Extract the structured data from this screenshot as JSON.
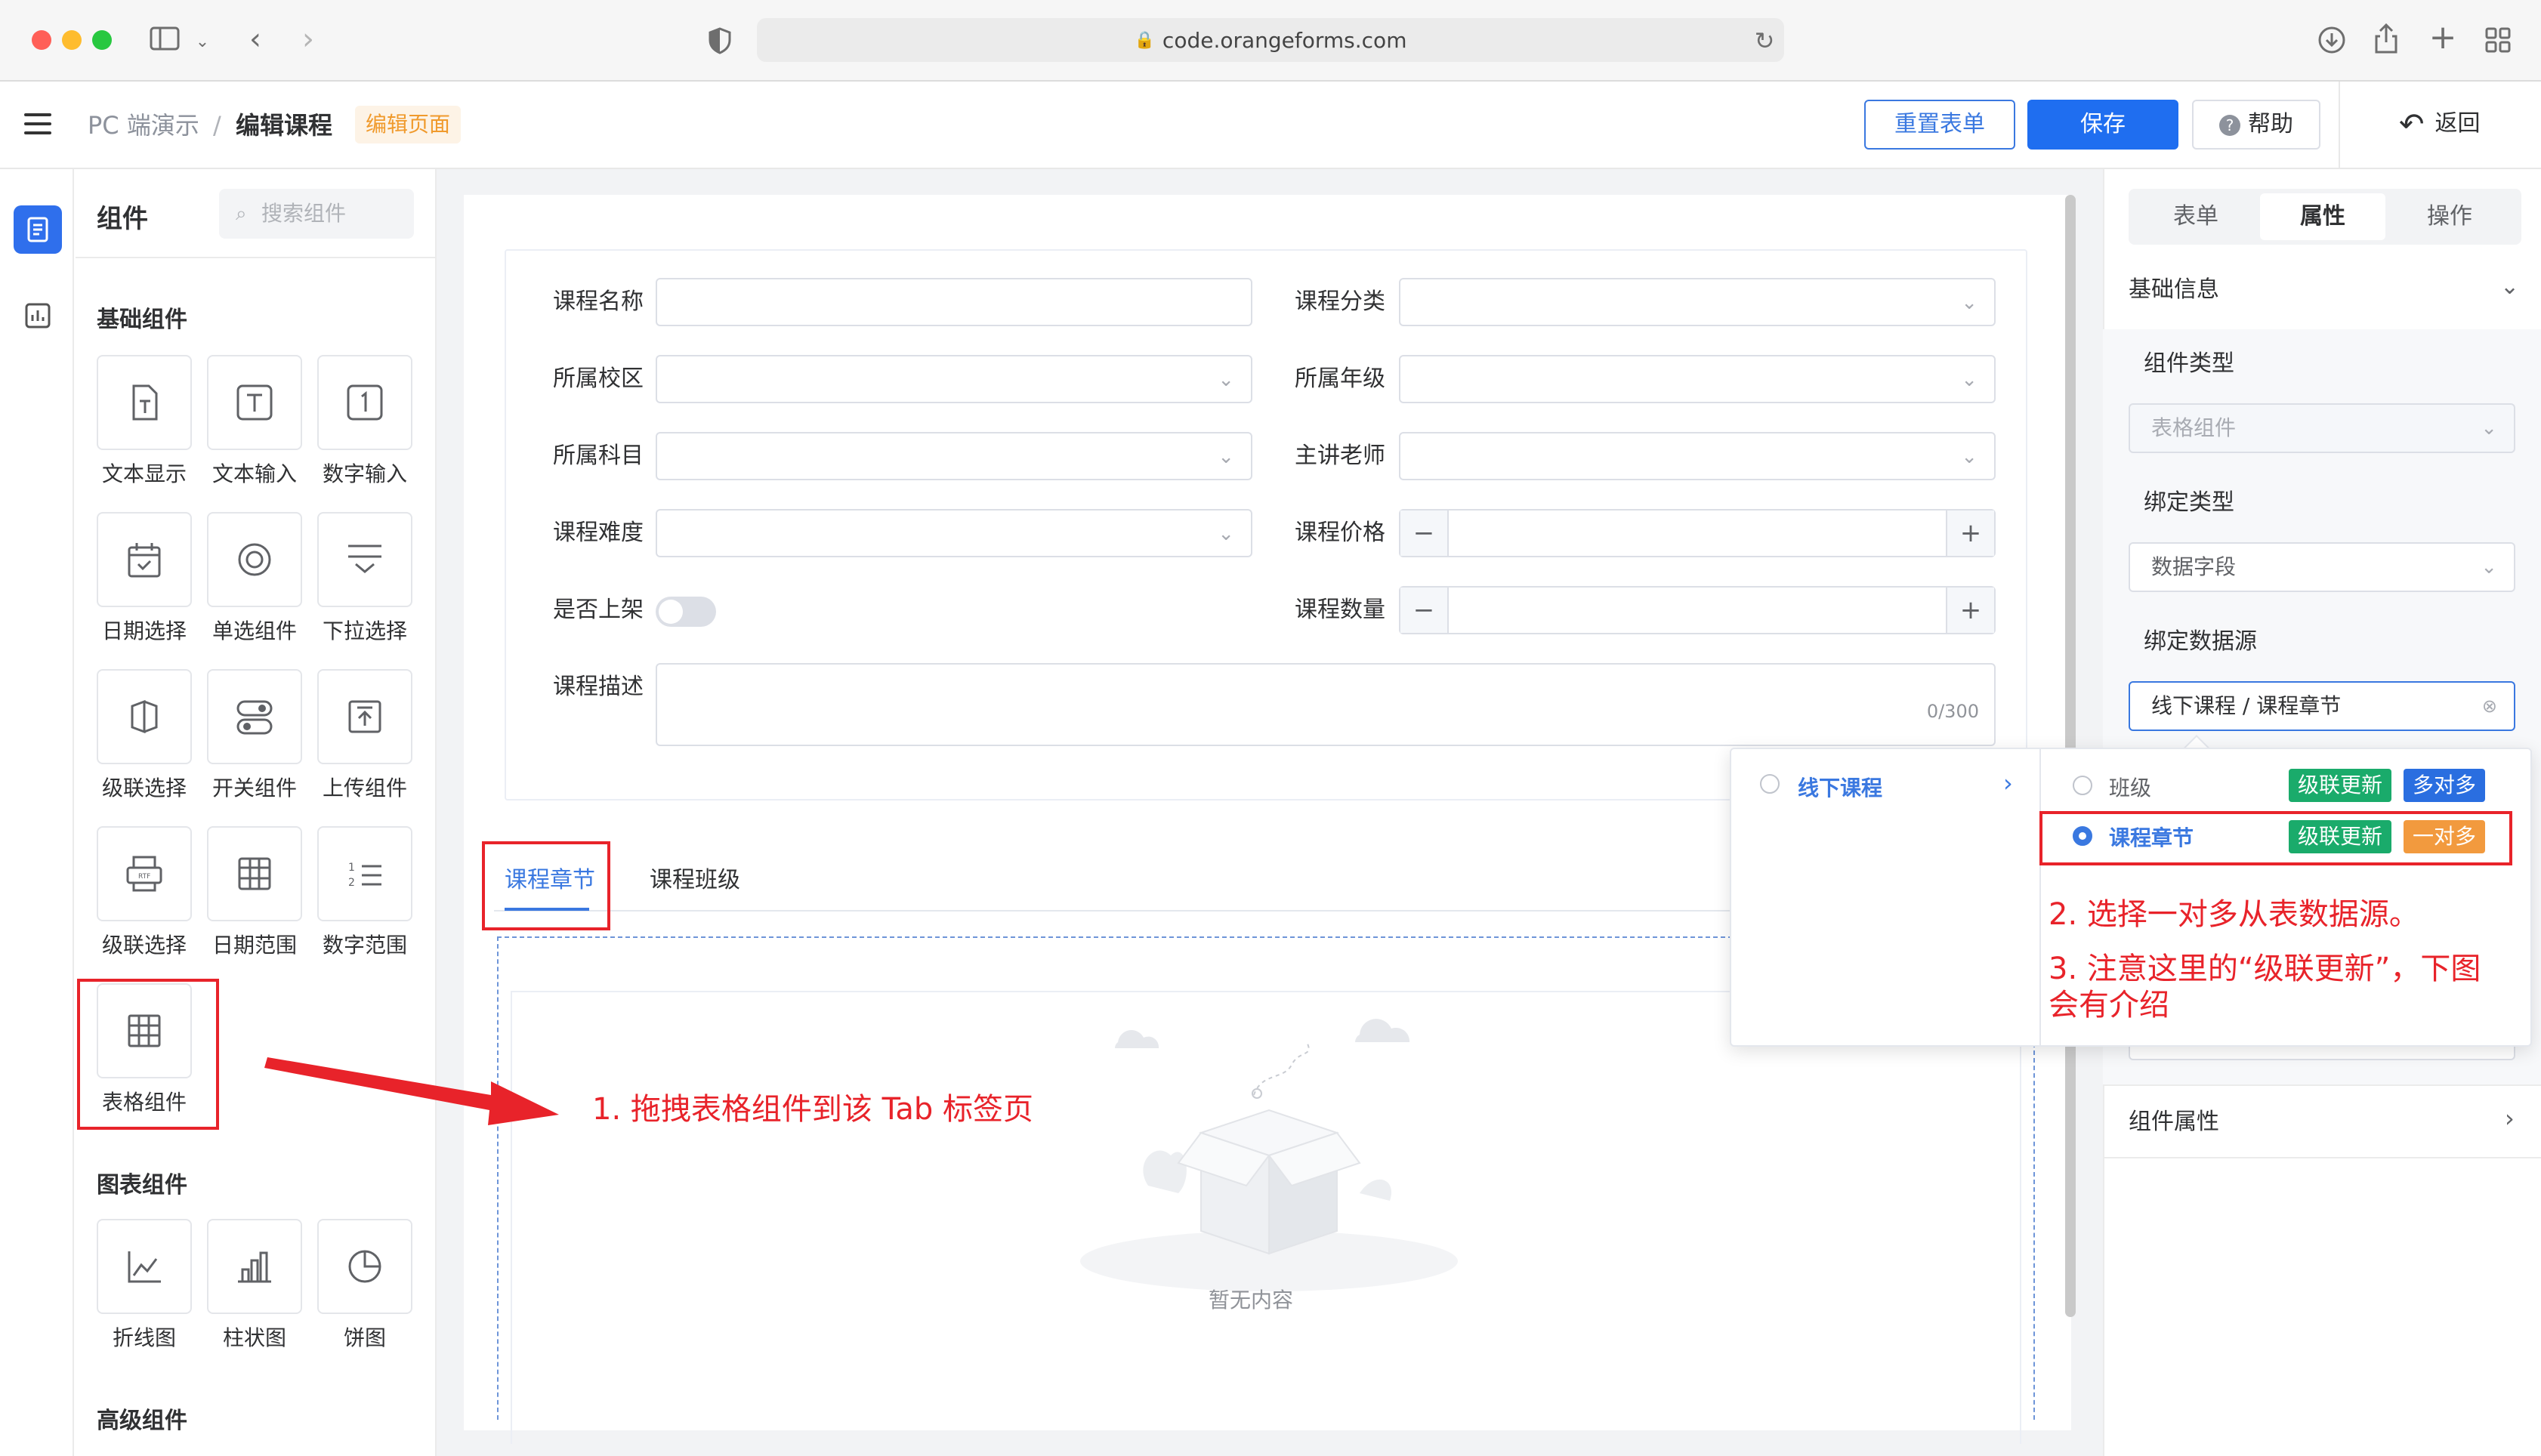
{
  "browser": {
    "url": "code.orangeforms.com"
  },
  "header": {
    "breadcrumb_parent": "PC 端演示",
    "breadcrumb_separator": "/",
    "breadcrumb_current": "编辑课程",
    "page_tag": "编辑页面",
    "reset_label": "重置表单",
    "save_label": "保存",
    "help_label": "帮助",
    "back_label": "返回"
  },
  "components": {
    "title": "组件",
    "search_placeholder": "搜索组件",
    "basic_title": "基础组件",
    "basic": [
      {
        "label": "文本显示",
        "icon": "text-display-icon"
      },
      {
        "label": "文本输入",
        "icon": "text-input-icon"
      },
      {
        "label": "数字输入",
        "icon": "number-input-icon"
      },
      {
        "label": "日期选择",
        "icon": "date-picker-icon"
      },
      {
        "label": "单选组件",
        "icon": "radio-icon"
      },
      {
        "label": "下拉选择",
        "icon": "dropdown-icon"
      },
      {
        "label": "级联选择",
        "icon": "cascader-icon"
      },
      {
        "label": "开关组件",
        "icon": "switch-icon"
      },
      {
        "label": "上传组件",
        "icon": "upload-icon"
      },
      {
        "label": "级联选择",
        "icon": "rich-text-icon"
      },
      {
        "label": "日期范围",
        "icon": "date-range-icon"
      },
      {
        "label": "数字范围",
        "icon": "number-range-icon"
      },
      {
        "label": "表格组件",
        "icon": "table-icon"
      }
    ],
    "chart_title": "图表组件",
    "charts": [
      {
        "label": "折线图",
        "icon": "line-chart-icon"
      },
      {
        "label": "柱状图",
        "icon": "bar-chart-icon"
      },
      {
        "label": "饼图",
        "icon": "pie-chart-icon"
      }
    ],
    "advanced_title": "高级组件"
  },
  "form": {
    "course_name": "课程名称",
    "course_category": "课程分类",
    "campus": "所属校区",
    "grade": "所属年级",
    "subject": "所属科目",
    "teacher": "主讲老师",
    "difficulty": "课程难度",
    "price": "课程价格",
    "on_sale": "是否上架",
    "quantity": "课程数量",
    "description": "课程描述",
    "description_counter": "0/300",
    "minus": "−",
    "plus": "+"
  },
  "tabs": {
    "chapters": "课程章节",
    "classes": "课程班级"
  },
  "table": {
    "empty_text": "暂无内容"
  },
  "properties": {
    "tabs": [
      "表单",
      "属性",
      "操作"
    ],
    "basic_info": "基础信息",
    "component_type_label": "组件类型",
    "component_type_value": "表格组件",
    "bind_type_label": "绑定类型",
    "bind_type_value": "数据字段",
    "bind_source_label": "绑定数据源",
    "bind_source_value": "线下课程 / 课程章节",
    "component_props": "组件属性"
  },
  "cascader": {
    "level1": "线下课程",
    "options": [
      {
        "label": "班级",
        "badge1": "级联更新",
        "badge2": "多对多",
        "selected": false
      },
      {
        "label": "课程章节",
        "badge1": "级联更新",
        "badge2": "一对多",
        "selected": true
      }
    ]
  },
  "annotations": {
    "step1": "1. 拖拽表格组件到该 Tab 标签页",
    "step2": "2. 选择一对多从表数据源。",
    "step3_line1": "3. 注意这里的“级联更新”，下图",
    "step3_line2": "会有介绍"
  },
  "colors": {
    "primary": "#1f6ef0",
    "badge_green": "#1aab6b",
    "badge_blue": "#2a6ee0",
    "badge_orange": "#f29a3e",
    "annotation_red": "#e8232a"
  }
}
